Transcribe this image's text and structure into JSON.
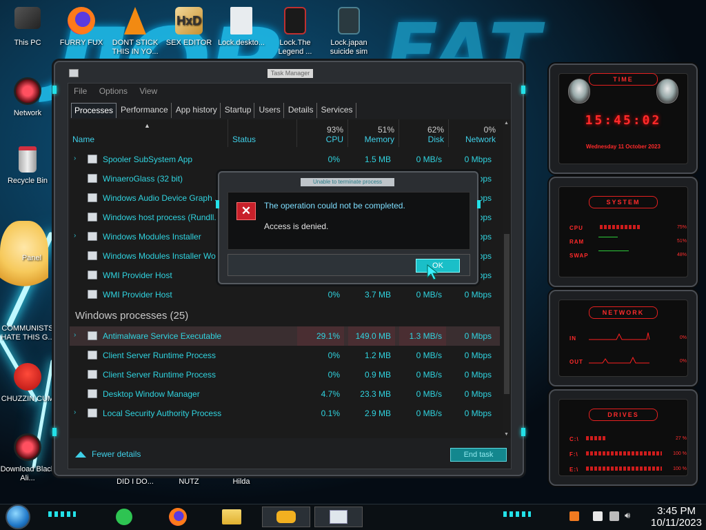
{
  "desktop": {
    "icons": [
      {
        "label": "This PC"
      },
      {
        "label": "FURRY FUX"
      },
      {
        "label": "DONT STICK THIS IN YO..."
      },
      {
        "label": "SEX EDITOR"
      },
      {
        "label": "Lock.deskto..."
      },
      {
        "label": "Lock.The Legend ..."
      },
      {
        "label": "Lock.japan suicide sim"
      },
      {
        "label": "Network"
      },
      {
        "label": "Recycle Bin"
      },
      {
        "label": "Panel"
      },
      {
        "label": "COMMUNISTS HATE THIS G..."
      },
      {
        "label": "CHUZZIN CUM"
      },
      {
        "label": "Download Black Ali..."
      },
      {
        "label": "DID I DO..."
      },
      {
        "label": "NUTZ"
      },
      {
        "label": "Hilda"
      }
    ]
  },
  "taskmanager": {
    "title": "Task Manager",
    "menu": [
      "File",
      "Options",
      "View"
    ],
    "tabs": [
      "Processes",
      "Performance",
      "App history",
      "Startup",
      "Users",
      "Details",
      "Services"
    ],
    "columns": {
      "name": "Name",
      "status": "Status",
      "cpu": {
        "pct": "93%",
        "label": "CPU"
      },
      "memory": {
        "pct": "51%",
        "label": "Memory"
      },
      "disk": {
        "pct": "62%",
        "label": "Disk"
      },
      "network": {
        "pct": "0%",
        "label": "Network"
      }
    },
    "rows_top": [
      {
        "name": "Spooler SubSystem App",
        "cpu": "0%",
        "memory": "1.5 MB",
        "disk": "0 MB/s",
        "network": "0 Mbps",
        "expand": "›"
      },
      {
        "name": "WinaeroGlass (32 bit)",
        "cpu": "",
        "memory": "",
        "disk": "",
        "network": "bps",
        "expand": ""
      },
      {
        "name": "Windows Audio Device Graph ...",
        "cpu": "",
        "memory": "",
        "disk": "",
        "network": "bps",
        "expand": ""
      },
      {
        "name": "Windows host process (Rundll...",
        "cpu": "",
        "memory": "",
        "disk": "",
        "network": "bps",
        "expand": ""
      },
      {
        "name": "Windows Modules Installer",
        "cpu": "",
        "memory": "",
        "disk": "",
        "network": "bps",
        "expand": "›"
      },
      {
        "name": "Windows Modules Installer Wo...",
        "cpu": "",
        "memory": "",
        "disk": "",
        "network": "bps",
        "expand": ""
      },
      {
        "name": "WMI Provider Host",
        "cpu": "",
        "memory": "",
        "disk": "",
        "network": "Mbps",
        "expand": ""
      },
      {
        "name": "WMI Provider Host",
        "cpu": "0%",
        "memory": "3.7 MB",
        "disk": "0 MB/s",
        "network": "0 Mbps",
        "expand": ""
      }
    ],
    "group_label": "Windows processes (25)",
    "rows_bottom": [
      {
        "name": "Antimalware Service Executable",
        "cpu": "29.1%",
        "memory": "149.0 MB",
        "disk": "1.3 MB/s",
        "network": "0 Mbps",
        "expand": "›"
      },
      {
        "name": "Client Server Runtime Process",
        "cpu": "0%",
        "memory": "1.2 MB",
        "disk": "0 MB/s",
        "network": "0 Mbps",
        "expand": ""
      },
      {
        "name": "Client Server Runtime Process",
        "cpu": "0%",
        "memory": "0.9 MB",
        "disk": "0 MB/s",
        "network": "0 Mbps",
        "expand": ""
      },
      {
        "name": "Desktop Window Manager",
        "cpu": "4.7%",
        "memory": "23.3 MB",
        "disk": "0 MB/s",
        "network": "0 Mbps",
        "expand": ""
      },
      {
        "name": "Local Security Authority Process",
        "cpu": "0.1%",
        "memory": "2.9 MB",
        "disk": "0 MB/s",
        "network": "0 Mbps",
        "expand": "›"
      }
    ],
    "fewer_details": "Fewer details",
    "end_task": "End task"
  },
  "dialog": {
    "title": "Unable to terminate process",
    "message": "The operation could not be completed.",
    "detail": "Access is denied.",
    "ok": "OK"
  },
  "gadgets": {
    "time": {
      "title": "TIME",
      "clock": "15:45:02",
      "date": "Wednesday 11 October 2023"
    },
    "system": {
      "title": "SYSTEM",
      "cpu_label": "CPU",
      "cpu_val": "75%",
      "ram_label": "RAM",
      "ram_val": "51%",
      "swap_label": "SWAP",
      "swap_val": "48%"
    },
    "network": {
      "title": "NETWORK",
      "in_label": "IN",
      "in_val": "0%",
      "out_label": "OUT",
      "out_val": "0%"
    },
    "drives": {
      "title": "DRIVES",
      "rows": [
        {
          "label": "C:\\",
          "val": "27 %"
        },
        {
          "label": "F:\\",
          "val": "100 %"
        },
        {
          "label": "E:\\",
          "val": "100 %"
        }
      ]
    }
  },
  "taskbar": {
    "time": "3:45 PM",
    "date": "10/11/2023",
    "apps": [
      "notes-icon",
      "firefox-icon",
      "file-explorer-icon",
      "handshake-icon",
      "task-manager-icon"
    ]
  }
}
